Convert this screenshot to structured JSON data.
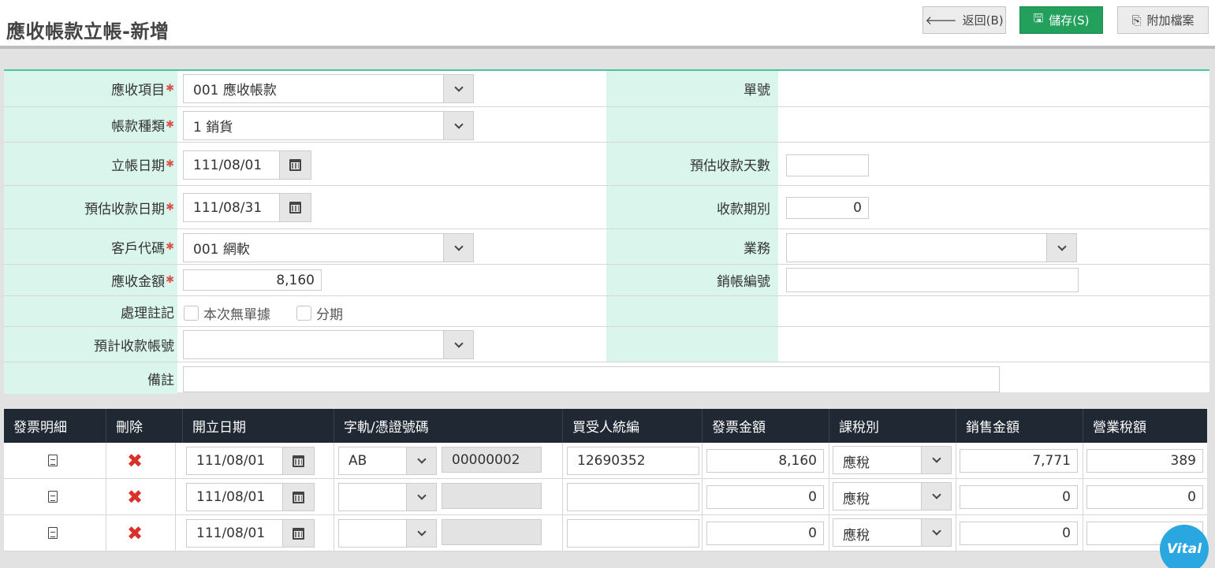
{
  "header": {
    "title": "應收帳款立帳-新增",
    "back_label": "返回(B)",
    "save_label": "儲存(S)",
    "attach_label": "附加檔案"
  },
  "form": {
    "ar_item": {
      "label": "應收項目",
      "value": "001 應收帳款"
    },
    "account_type": {
      "label": "帳款種類",
      "value": "1 銷貨"
    },
    "post_date": {
      "label": "立帳日期",
      "value": "111/08/01"
    },
    "est_date": {
      "label": "預估收款日期",
      "value": "111/08/31"
    },
    "customer": {
      "label": "客戶代碼",
      "value": "001 網軟"
    },
    "amount": {
      "label": "應收金額",
      "value": "8,160"
    },
    "flags": {
      "label": "處理註記",
      "no_doc": "本次無單據",
      "installment": "分期"
    },
    "est_account": {
      "label": "預計收款帳號",
      "value": ""
    },
    "remark": {
      "label": "備註",
      "value": ""
    },
    "doc_no": {
      "label": "單號",
      "value": ""
    },
    "est_days": {
      "label": "預估收款天數",
      "value": ""
    },
    "period": {
      "label": "收款期別",
      "value": "0"
    },
    "sales": {
      "label": "業務",
      "value": ""
    },
    "writeoff_no": {
      "label": "銷帳編號",
      "value": ""
    }
  },
  "invoice_grid": {
    "columns": [
      "發票明細",
      "刪除",
      "開立日期",
      "字軌/憑證號碼",
      "買受人統編",
      "發票金額",
      "課稅別",
      "銷售金額",
      "營業稅額"
    ],
    "rows": [
      {
        "date": "111/08/01",
        "track": "AB",
        "number": "00000002",
        "buyer_id": "12690352",
        "inv_amount": "8,160",
        "tax_type": "應稅",
        "sales_amount": "7,771",
        "tax_amount": "389"
      },
      {
        "date": "111/08/01",
        "track": "",
        "number": "",
        "buyer_id": "",
        "inv_amount": "0",
        "tax_type": "應稅",
        "sales_amount": "0",
        "tax_amount": "0"
      },
      {
        "date": "111/08/01",
        "track": "",
        "number": "",
        "buyer_id": "",
        "inv_amount": "0",
        "tax_type": "應稅",
        "sales_amount": "0",
        "tax_amount": ""
      }
    ]
  },
  "badge": {
    "text": "Vital"
  },
  "colors": {
    "accent": "#23a15c",
    "label_bg": "#d9f5ec",
    "header_bg": "#202833",
    "delete": "#d9302a"
  }
}
